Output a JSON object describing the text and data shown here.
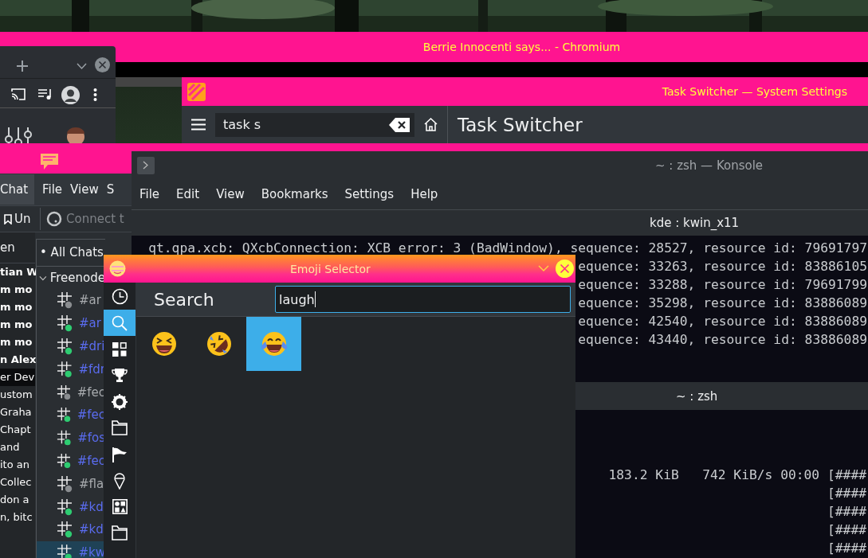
{
  "chromium": {
    "title": "Berrie Innocenti says... - Chromium"
  },
  "settings": {
    "title": "Task Switcher — System Settings",
    "search": {
      "value": "task s"
    },
    "heading": "Task Switcher"
  },
  "chat": {
    "tab": "Chat",
    "menu": [
      "File",
      "View",
      "S"
    ],
    "bookmark": "Un",
    "connect": "Connect t",
    "nick_header": "en",
    "messages": [
      {
        "text": "tian W",
        "unread": true,
        "selected": false
      },
      {
        "text": "m mo",
        "unread": true,
        "selected": false
      },
      {
        "text": "m mo",
        "unread": true,
        "selected": false
      },
      {
        "text": "m mo",
        "unread": true,
        "selected": false
      },
      {
        "text": "m mo",
        "unread": true,
        "selected": false
      },
      {
        "text": "n Alex",
        "unread": true,
        "selected": false
      },
      {
        "text": "er Dev",
        "unread": false,
        "selected": true
      },
      {
        "text": "ustom",
        "unread": false,
        "selected": false
      },
      {
        "text": "Graha",
        "unread": false,
        "selected": false
      },
      {
        "text": "Chapt",
        "unread": false,
        "selected": false
      },
      {
        "text": "and",
        "unread": false,
        "selected": false
      },
      {
        "text": "ito an",
        "unread": false,
        "selected": false
      },
      {
        "text": "Collec",
        "unread": false,
        "selected": false
      },
      {
        "text": "don a",
        "unread": false,
        "selected": false
      },
      {
        "text": "n, bitc",
        "unread": false,
        "selected": false
      }
    ],
    "filter": "• All Chats",
    "tree": {
      "label": "Freenode",
      "expanded": true,
      "children": [
        {
          "label": "#ar",
          "online": false,
          "selected": false
        },
        {
          "label": "#ar",
          "online": true,
          "selected": false
        },
        {
          "label": "#dri",
          "online": true,
          "selected": false
        },
        {
          "label": "#fdr",
          "online": true,
          "selected": false
        },
        {
          "label": "#fec",
          "online": false,
          "selected": false
        },
        {
          "label": "#fec",
          "online": true,
          "selected": false
        },
        {
          "label": "#fos",
          "online": true,
          "selected": false
        },
        {
          "label": "#fec",
          "online": true,
          "selected": false
        },
        {
          "label": "#fla",
          "online": false,
          "selected": false
        },
        {
          "label": "#kd",
          "online": true,
          "selected": false
        },
        {
          "label": "#kd",
          "online": true,
          "selected": false
        },
        {
          "label": "#kw",
          "online": true,
          "selected": true
        }
      ]
    }
  },
  "konsole": {
    "title": "~ : zsh — Konsole",
    "menu": [
      "File",
      "Edit",
      "View",
      "Bookmarks",
      "Settings",
      "Help"
    ],
    "tab": "kde : kwin_x11",
    "lines": [
      "qt.qpa.xcb: QXcbConnection: XCB error: 3 (BadWindow), sequence: 28527, resource id: 79691797",
      "equence: 33263, resource id: 83886105",
      "equence: 33288, resource id: 79691799",
      "equence: 35298, resource id: 83886089",
      "equence: 42540, resource id: 83886089",
      "equence: 43440, resource id: 83886089"
    ],
    "split": {
      "title": "~ : zsh",
      "lines": [
        "183.2 KiB   742 KiB/s 00:00 [####",
        "[####",
        "[####",
        "[####",
        "[####"
      ]
    }
  },
  "emoji_selector": {
    "title": "Emoji Selector",
    "search_label": "Search",
    "search": {
      "value": "laugh"
    },
    "categories": [
      {
        "kind": "clock",
        "selected": false
      },
      {
        "kind": "search",
        "selected": true
      },
      {
        "kind": "grid",
        "selected": false
      },
      {
        "kind": "trophy",
        "selected": false
      },
      {
        "kind": "gear",
        "selected": false
      },
      {
        "kind": "folder",
        "selected": false
      },
      {
        "kind": "flag",
        "selected": false
      },
      {
        "kind": "icecream",
        "selected": false
      },
      {
        "kind": "shapes",
        "selected": false
      },
      {
        "kind": "folder",
        "selected": false
      }
    ],
    "emojis": [
      {
        "kind": "grin",
        "selected": false
      },
      {
        "kind": "rofl",
        "selected": false
      },
      {
        "kind": "tears",
        "selected": true
      }
    ]
  }
}
